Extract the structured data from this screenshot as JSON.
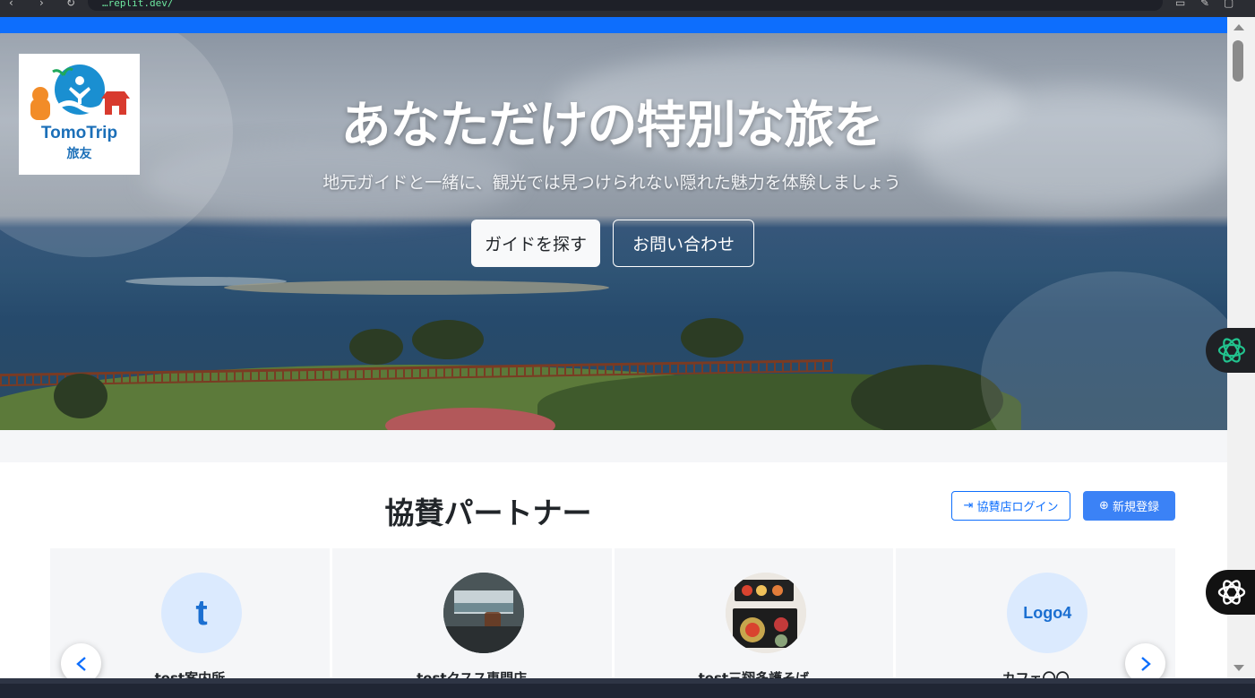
{
  "browser": {
    "url": "…replit.dev/"
  },
  "hero": {
    "logo_name": "TomoTrip",
    "logo_sub": "旅友",
    "title": "あなただけの特別な旅を",
    "subtitle": "地元ガイドと一緒に、観光では見つけられない隠れた魅力を体験しましょう",
    "btn_find": "ガイドを探す",
    "btn_contact": "お問い合わせ"
  },
  "partners": {
    "title": "協賛パートナー",
    "login_label": "協賛店ログイン",
    "register_label": "新規登録",
    "cards": [
      {
        "name": "test案内所",
        "avatar_text": "t"
      },
      {
        "name": "testクスス専門店",
        "avatar_text": ""
      },
      {
        "name": "test三翔多護そば",
        "avatar_text": ""
      },
      {
        "name": "カフェ〇〇",
        "avatar_text": "Logo4"
      }
    ]
  },
  "colors": {
    "accent": "#0d6efd",
    "register": "#3b82f6",
    "brand": "#1b6fb8"
  }
}
